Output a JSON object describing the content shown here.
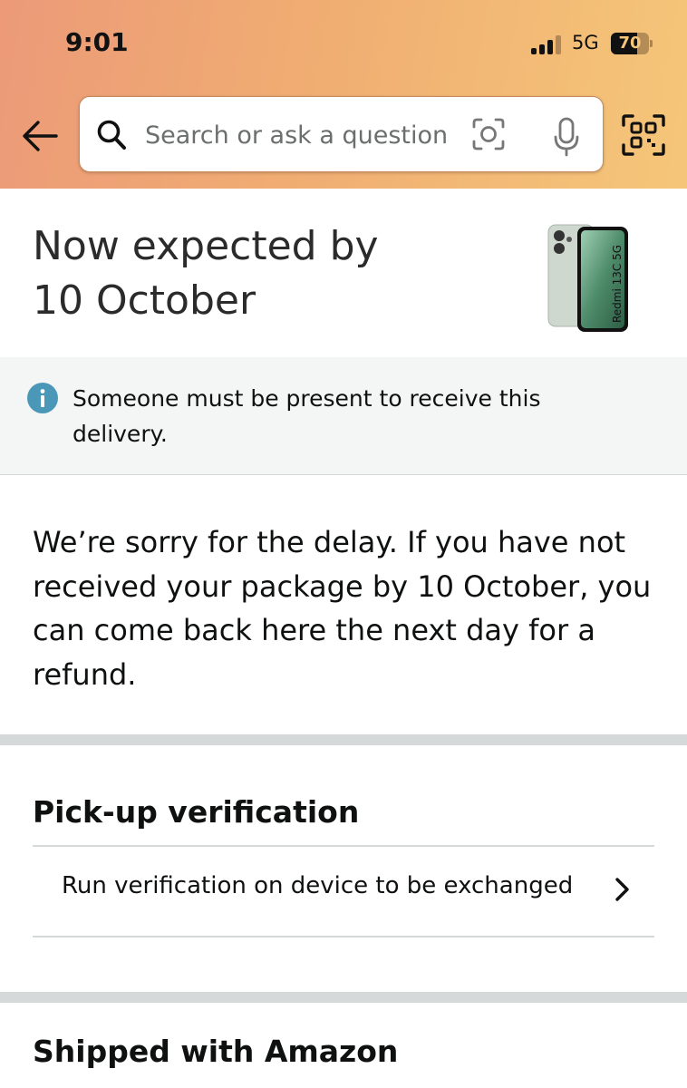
{
  "status_bar": {
    "time": "9:01",
    "network": "5G",
    "battery": "70",
    "battery_level": 0.7
  },
  "search": {
    "placeholder": "Search or ask a question"
  },
  "delivery": {
    "eta_line1": "Now expected by",
    "eta_line2": "10 October",
    "product_image_text": "Redmi 13C 5G"
  },
  "alert": {
    "text": "Someone must be present to receive this delivery."
  },
  "delay_message": "We’re sorry for the delay. If you have not received your package by 10 October, you can come back here the next day for a refund.",
  "pickup": {
    "heading": "Pick-up verification",
    "row_label": "Run verification on device to be exchanged"
  },
  "shipped": {
    "heading": "Shipped with Amazon"
  },
  "colors": {
    "info_icon": "#4a97b8",
    "separator": "#d5d9d9",
    "alert_bg": "#f4f6f6"
  },
  "icons": [
    "back-arrow-icon",
    "search-icon",
    "camera-lens-icon",
    "microphone-icon",
    "qr-scan-icon",
    "info-icon",
    "chevron-right-icon"
  ]
}
